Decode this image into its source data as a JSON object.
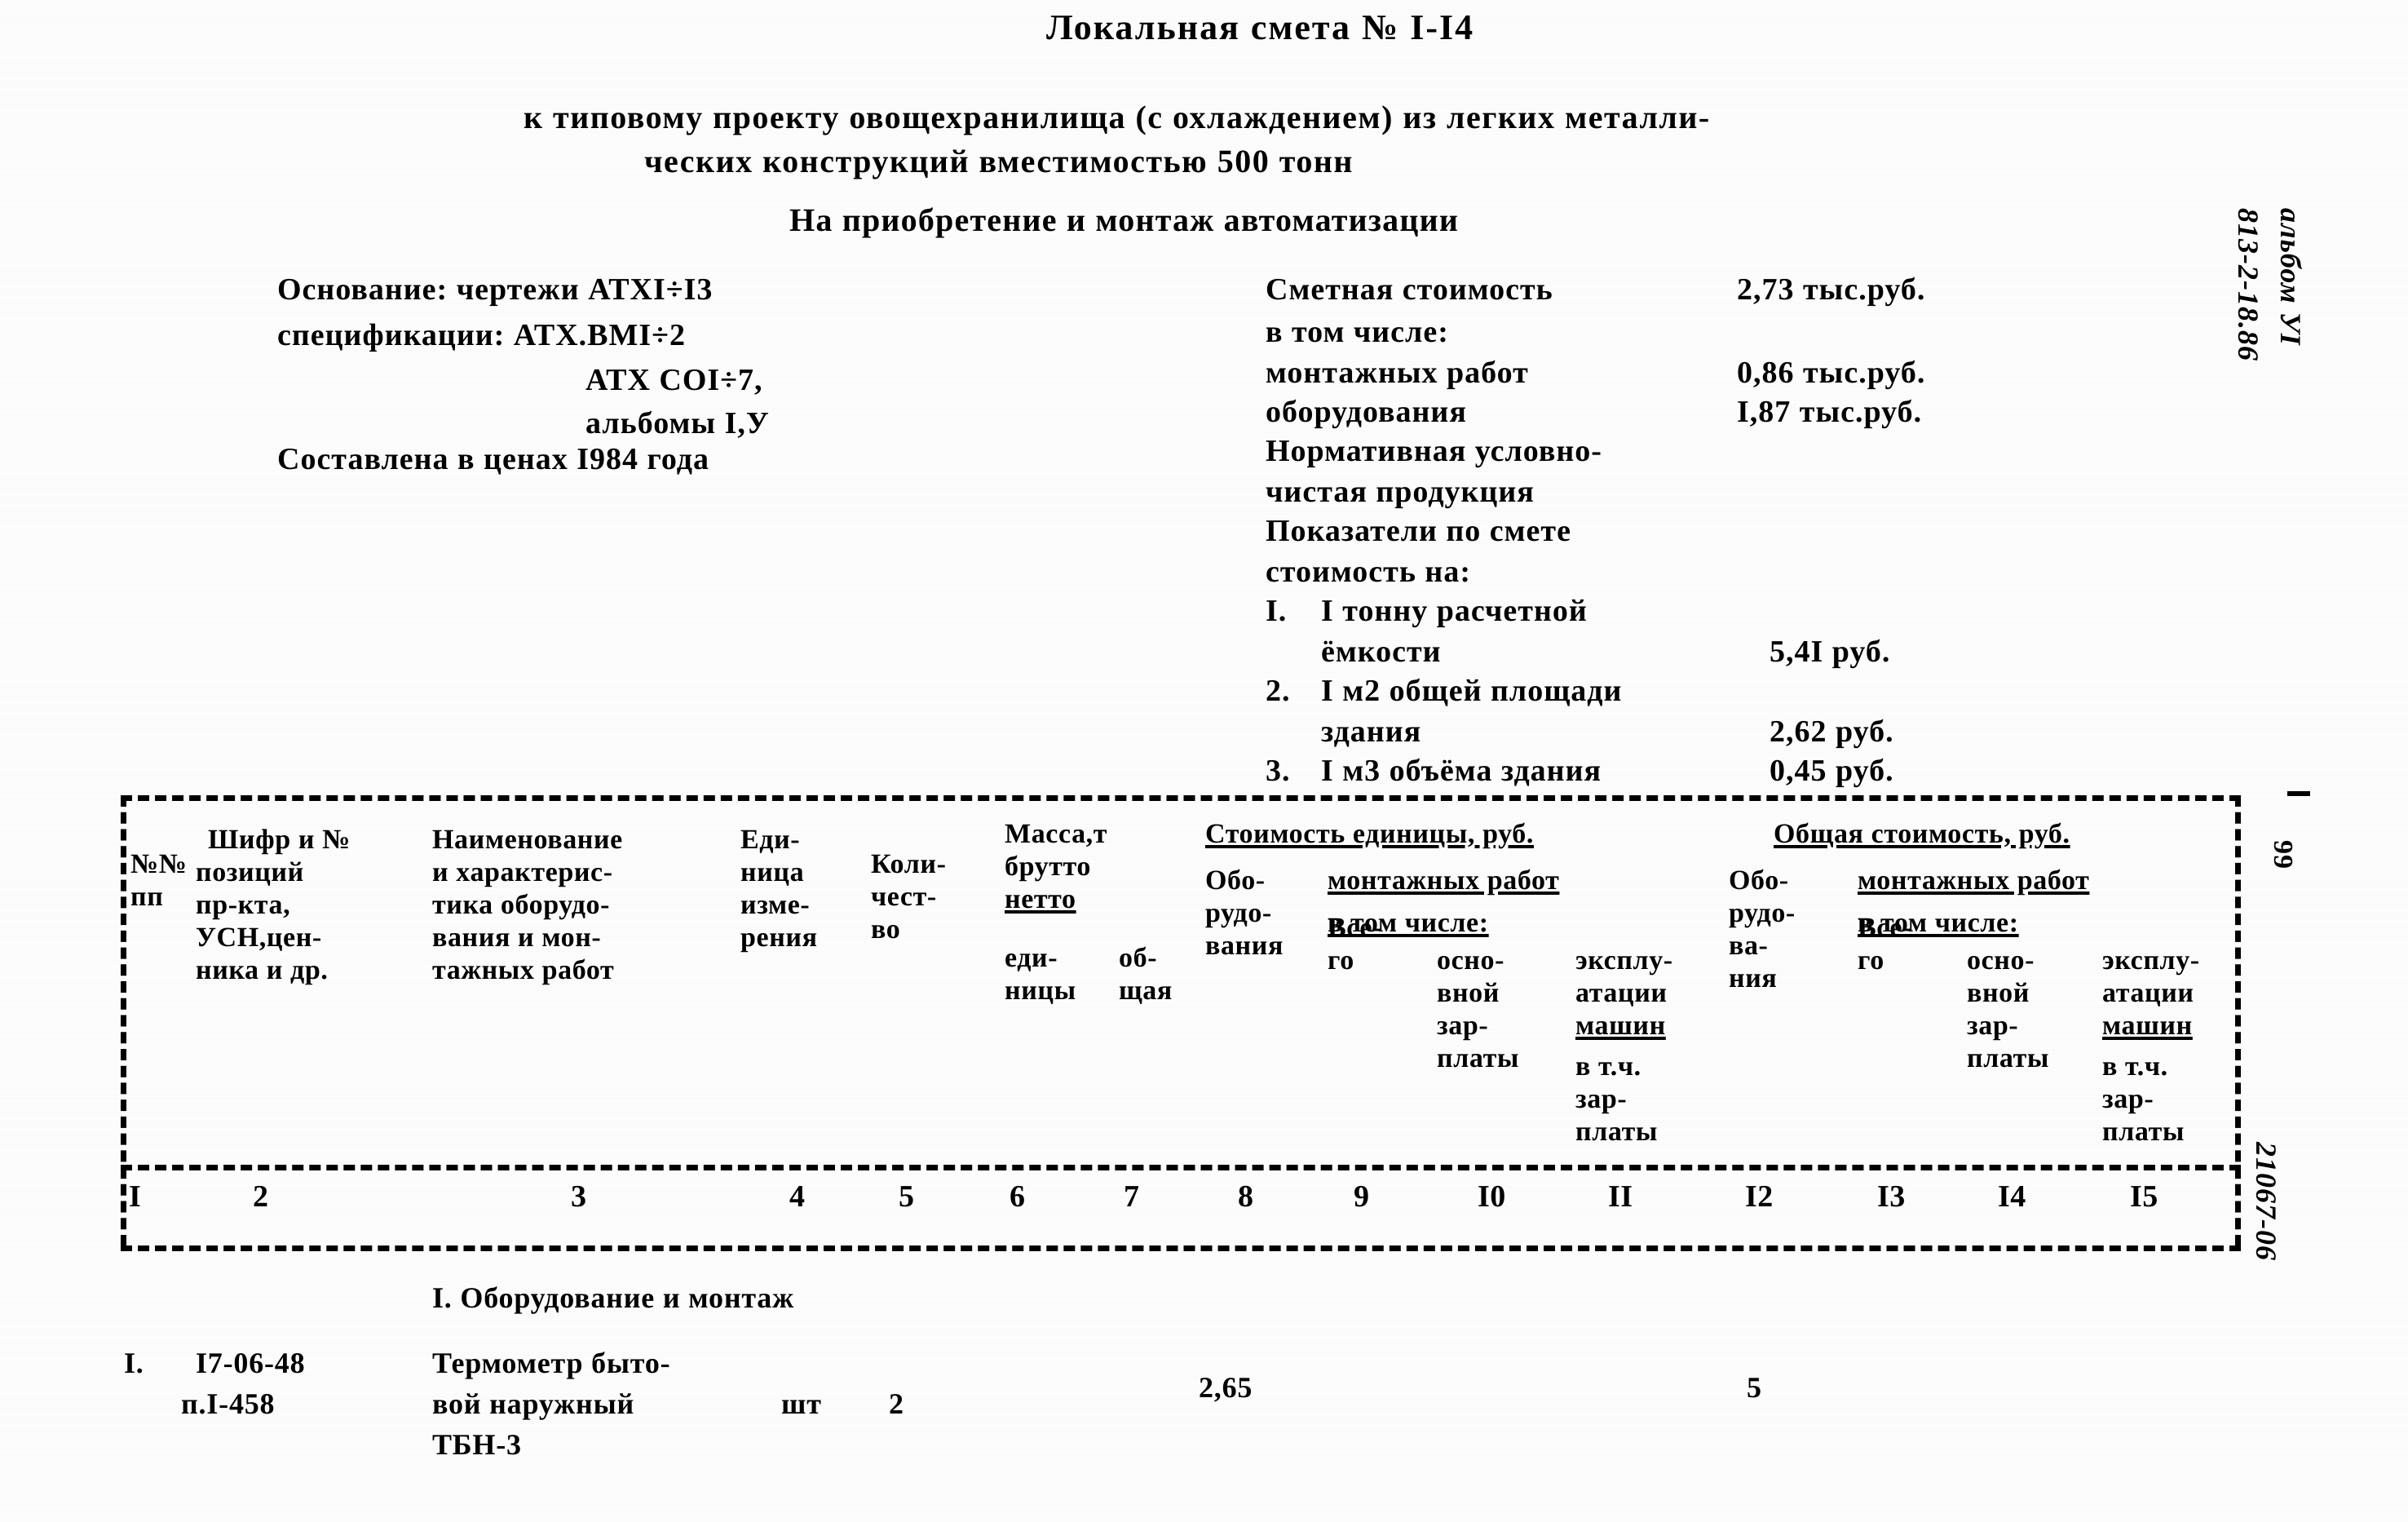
{
  "document": {
    "title": "Локальная смета № I-I4",
    "subtitle_line1": "к типовому проекту овощехранилища (с охлаждением) из легких металли-",
    "subtitle_line2": "ческих конструкций вместимостью 500 тонн",
    "subtitle_line3": "На приобретение и монтаж автоматизации"
  },
  "basis": {
    "line1": "Основание: чертежи АТХI÷I3",
    "line2": "спецификации: АТХ.ВМI÷2",
    "line3": "АТХ СОI÷7,",
    "line4": "альбомы I,У",
    "line5": "Составлена в ценах I984 года"
  },
  "cost_summary": {
    "label_total": "Сметная стоимость",
    "value_total": "2,73 тыс.руб.",
    "label_including": "в том числе:",
    "label_installation": "монтажных работ",
    "value_installation": "0,86 тыс.руб.",
    "label_equipment": "оборудования",
    "value_equipment": "I,87 тыс.руб.",
    "label_normative_1": "Нормативная условно-",
    "label_normative_2": "чистая продукция",
    "label_indicators_1": "Показатели по смете",
    "label_indicators_2": "стоимость на:",
    "indicators": [
      {
        "num": "I.",
        "text_line1": "I тонну расчетной",
        "text_line2": "ёмкости",
        "value": "5,4I руб."
      },
      {
        "num": "2.",
        "text_line1": "I м2 общей площади",
        "text_line2": "здания",
        "value": "2,62 руб."
      },
      {
        "num": "3.",
        "text_line1": "I м3 объёма здания",
        "text_line2": "",
        "value": "0,45 руб."
      }
    ]
  },
  "margin_notes": {
    "album": "альбом УI",
    "code": "813-2-18.86",
    "page": "99",
    "doc_number": "21067-06"
  },
  "table": {
    "headers": {
      "col1_line1": "№№",
      "col1_line2": "пп",
      "col2_line1": "Шифр и №",
      "col2_line2": "позиций",
      "col2_line3": "пр-кта,",
      "col2_line4": "УСН,цен-",
      "col2_line5": "ника и др.",
      "col3_line1": "Наименование",
      "col3_line2": "и характерис-",
      "col3_line3": "тика оборудо-",
      "col3_line4": "вания и мон-",
      "col3_line5": "тажных работ",
      "col4_line1": "Еди-",
      "col4_line2": "ница",
      "col4_line3": "изме-",
      "col4_line4": "рения",
      "col5_line1": "Коли-",
      "col5_line2": "чест-",
      "col5_line3": "во",
      "col6_line1": "Масса,т",
      "col6_line2": "брутто",
      "col6_line3": "нетто",
      "col6_line4": "еди-",
      "col6_line5": "ницы",
      "col7_line1": "об-",
      "col7_line2": "щая",
      "group_unit_cost": "Стоимость единицы, руб.",
      "group_total_cost": "Общая стоимость, руб.",
      "col8_line1": "Обо-",
      "col8_line2": "рудо-",
      "col8_line3": "вания",
      "sub_installation": "монтажных работ",
      "sub_including": "в том числе:",
      "col9_line1": "Все-",
      "col9_line2": "го",
      "col10_line1": "осно-",
      "col10_line2": "вной",
      "col10_line3": "зар-",
      "col10_line4": "платы",
      "col11_line1": "эксплу-",
      "col11_line2": "атации",
      "col11_line3": "машин",
      "col11_line4": "в т.ч.",
      "col11_line5": "зар-",
      "col11_line6": "платы",
      "col12_line1": "Обо-",
      "col12_line2": "рудо-",
      "col12_line3": "ва-",
      "col12_line4": "ния",
      "col13_line1": "Все-",
      "col13_line2": "го",
      "col14_line1": "осно-",
      "col14_line2": "вной",
      "col14_line3": "зар-",
      "col14_line4": "платы",
      "col15_line1": "эксплу-",
      "col15_line2": "атации",
      "col15_line3": "машин",
      "col15_line4": "в т.ч.",
      "col15_line5": "зар-",
      "col15_line6": "платы"
    },
    "column_numbers": [
      "I",
      "2",
      "3",
      "4",
      "5",
      "6",
      "7",
      "8",
      "9",
      "I0",
      "II",
      "I2",
      "I3",
      "I4",
      "I5"
    ],
    "section_title": "I. Оборудование и монтаж",
    "rows": [
      {
        "num": "I.",
        "code_line1": "I7-06-48",
        "code_line2": "п.I-458",
        "name_line1": "Термометр быто-",
        "name_line2": "вой наружный",
        "name_line3": "ТБН-3",
        "unit": "шт",
        "qty": "2",
        "mass_brutto": "",
        "mass_netto": "",
        "mass_total": "",
        "unit_equipment": "2,65",
        "unit_install_total": "",
        "unit_install_salary": "",
        "unit_install_machines": "",
        "total_equipment": "5",
        "total_install_total": "",
        "total_install_salary": "",
        "total_install_machines": ""
      }
    ]
  }
}
